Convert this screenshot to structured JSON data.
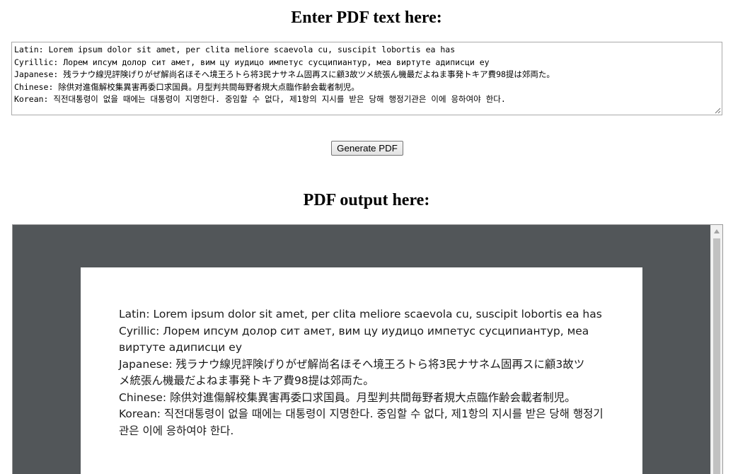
{
  "input_heading": "Enter PDF text here:",
  "textarea": {
    "lines": [
      "Latin: Lorem ipsum dolor sit amet, per clita meliore scaevola cu, suscipit lobortis ea has",
      "Cyrillic: Лорем ипсум долор сит амет, вим цу иудицо импетус сусципиантур, меа виртуте адиписци еу",
      "Japanese: 残ラナウ線児評険げりがぜ解尚名ほそへ境王ろトら将3民ナサネム固再スに顧3故ツメ統張ん機最だよねま事発トキア費98提は郊両た。",
      "Chinese: 除供对進傷解校集異害再委口求国員。月型判共間毎野者規大点臨作齢会載者制児。",
      "Korean: 직전대통령이 없을 때에는 대통령이 지명한다. 중임할 수 없다, 제1항의 지시를 받은 당해 행정기관은 이에 응하여야 한다."
    ]
  },
  "generate_button_label": "Generate PDF",
  "output_heading": "PDF output here:",
  "pdf_lines": [
    "Latin: Lorem ipsum dolor sit amet, per clita meliore scaevola cu, suscipit lobortis ea has",
    "Cyrillic: Лорем ипсум долор сит амет, вим цу иудицо импетус сусципиантур, меа",
    "виртуте адиписци еу",
    "Japanese: 残ラナウ線児評険げりがぜ解尚名ほそへ境王ろトら将3民ナサネム固再スに顧3故ツ",
    "メ統張ん機最だよねま事発トキア費98提は郊両た。",
    "Chinese: 除供対進傷解校集異害再委口求国員。月型判共間毎野者規大点臨作齢会載者制児。",
    "Korean: 직전대통령이 없을 때에는 대통령이 지명한다. 중임할 수 없다, 제1항의 지시를 받은 당해 행정기",
    "관은 이에 응하여야 한다."
  ],
  "colors": {
    "viewer_background": "#525659",
    "page_background": "#ffffff"
  }
}
